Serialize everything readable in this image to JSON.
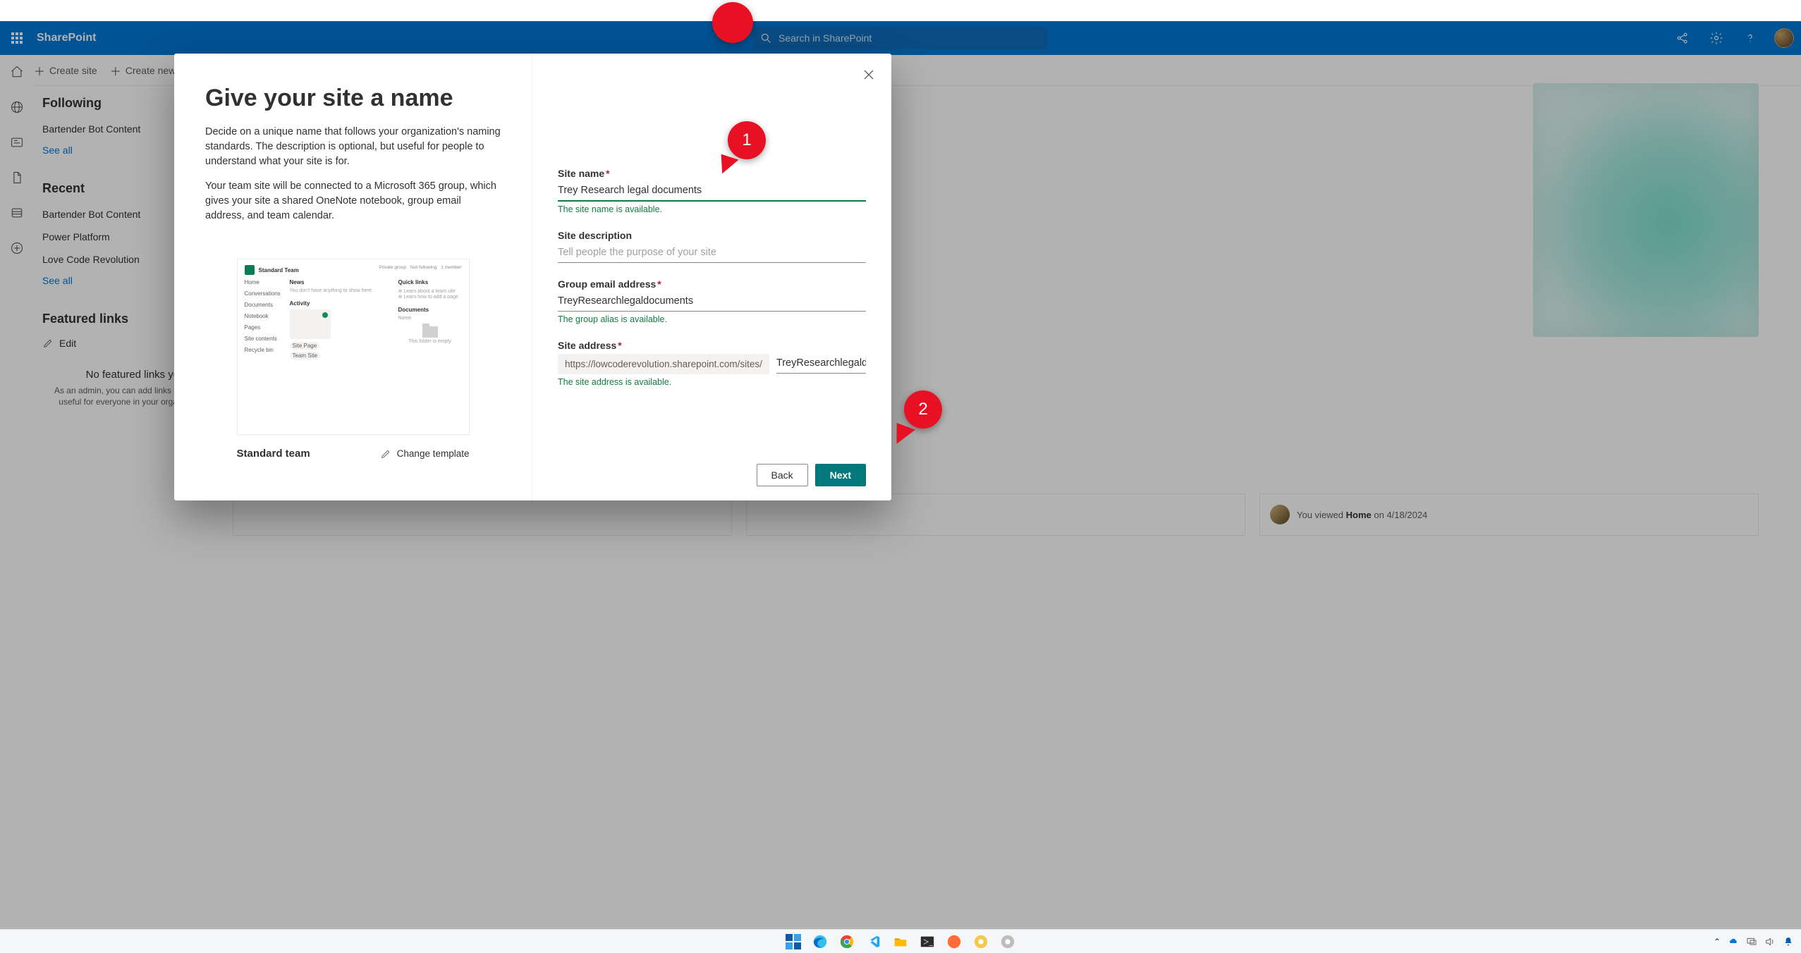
{
  "suitebar": {
    "brand": "SharePoint",
    "search_placeholder": "Search in SharePoint"
  },
  "cmdbar": {
    "create_site": "Create site",
    "create_news": "Create news post"
  },
  "startpage": {
    "following_h": "Following",
    "following_items": [
      "Bartender Bot Content"
    ],
    "see_all": "See all",
    "recent_h": "Recent",
    "recent_items": [
      "Bartender Bot Content",
      "Power Platform",
      "Love Code Revolution"
    ],
    "featured_h": "Featured links",
    "edit": "Edit",
    "no_featured_title": "No featured links yet",
    "no_featured_sub": "As an admin, you can add links that will be useful for everyone in your organization."
  },
  "card_strip": {
    "text_prefix": "You viewed ",
    "text_bold": "Home",
    "text_suffix": " on 4/18/2024"
  },
  "dialog": {
    "title": "Give your site a name",
    "para1": "Decide on a unique name that follows your organization's naming standards. The description is optional, but useful for people to understand what your site is for.",
    "para2": "Your team site will be connected to a Microsoft 365 group, which gives your site a shared OneNote notebook, group email address, and team calendar.",
    "template_name": "Standard team",
    "change_template": "Change template",
    "preview": {
      "title": "Standard Team",
      "nav": [
        "Home",
        "Conversations",
        "Documents",
        "Notebook",
        "Pages",
        "Site contents",
        "Recycle bin"
      ],
      "news_h": "News",
      "news_empty": "You don't have anything to show here.",
      "activity_h": "Activity",
      "ql_h": "Quick links",
      "ql1": "Learn about a team site",
      "ql2": "Learn how to add a page",
      "docs_h": "Documents",
      "docs_cols": "Name",
      "docs_empty": "This folder is empty",
      "top_r": [
        "Private group",
        "Not following",
        "1 member"
      ]
    },
    "form": {
      "site_name_label": "Site name",
      "site_name_value": "Trey Research legal documents",
      "site_name_hint": "The site name is available.",
      "desc_label": "Site description",
      "desc_placeholder": "Tell people the purpose of your site",
      "email_label": "Group email address",
      "email_value": "TreyResearchlegaldocuments",
      "email_hint": "The group alias is available.",
      "addr_label": "Site address",
      "addr_prefix": "https://lowcoderevolution.sharepoint.com/sites/",
      "addr_value": "TreyResearchlegaldocu...",
      "addr_hint": "The site address is available."
    },
    "back": "Back",
    "next": "Next"
  },
  "callouts": {
    "c1": "1",
    "c2": "2"
  }
}
